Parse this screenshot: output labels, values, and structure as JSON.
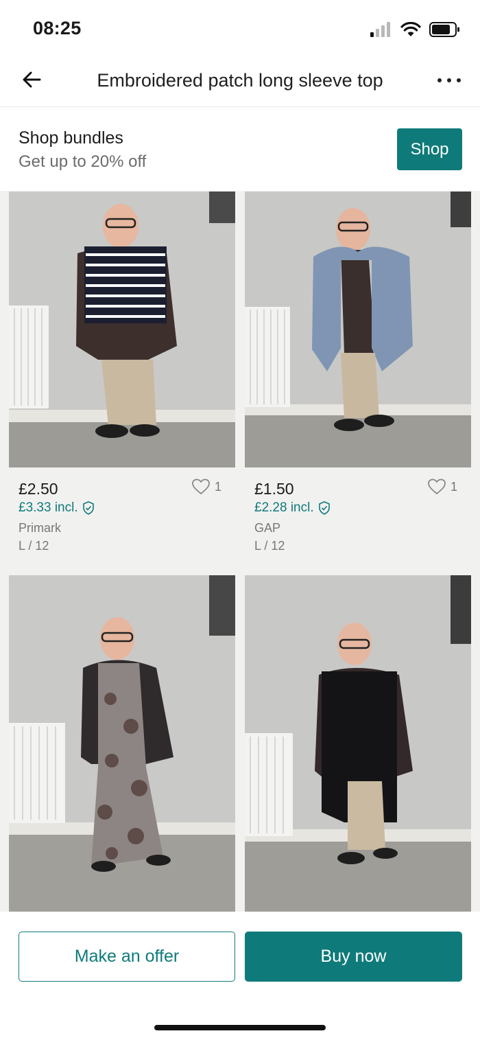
{
  "status_bar": {
    "time": "08:25",
    "icons": [
      "signal-icon",
      "wifi-icon",
      "battery-icon"
    ]
  },
  "header": {
    "title": "Embroidered patch long sleeve top",
    "back_icon": "back-arrow-icon",
    "more_icon": "more-icon"
  },
  "bundle_banner": {
    "title": "Shop bundles",
    "subtitle": "Get up to 20% off",
    "button_label": "Shop"
  },
  "items": [
    {
      "price": "£2.50",
      "price_incl": "£3.33 incl.",
      "brand": "Primark",
      "size": "L / 12",
      "favourites": "1",
      "outfit": "striped-top"
    },
    {
      "price": "£1.50",
      "price_incl": "£2.28 incl.",
      "brand": "GAP",
      "size": "L / 12",
      "favourites": "1",
      "outfit": "blue-cardigan"
    },
    {
      "outfit": "floral-dress"
    },
    {
      "outfit": "black-coat"
    }
  ],
  "actions": {
    "offer_label": "Make an offer",
    "buy_label": "Buy now"
  },
  "colors": {
    "accent": "#0f7a7a",
    "grid_background": "#f1f1f0"
  }
}
